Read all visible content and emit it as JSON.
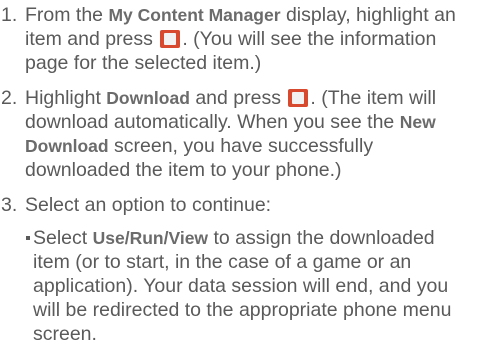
{
  "steps": [
    {
      "number": "1.",
      "parts": [
        "From the ",
        "My Content Manager",
        " display, highlight an item and press ",
        ". (You will see the information page for the selected item.)"
      ]
    },
    {
      "number": "2.",
      "parts": [
        "Highlight ",
        "Download",
        " and press ",
        ". (The item will download automatically. When you see the ",
        "New Download",
        " screen, you have successfully downloaded the item to your phone.)"
      ]
    },
    {
      "number": "3.",
      "text": "Select an option to continue:",
      "sub": {
        "parts": [
          "Select ",
          "Use/Run/View",
          " to assign the downloaded item (or to start, in the case of a game or an application). Your data session will end, and you will be redirected to the appropriate phone menu screen."
        ]
      }
    }
  ],
  "colors": {
    "body_text": "#5a5a5a",
    "key_button": "#d84a2f"
  },
  "icons": {
    "key": "center-select-key-icon"
  }
}
